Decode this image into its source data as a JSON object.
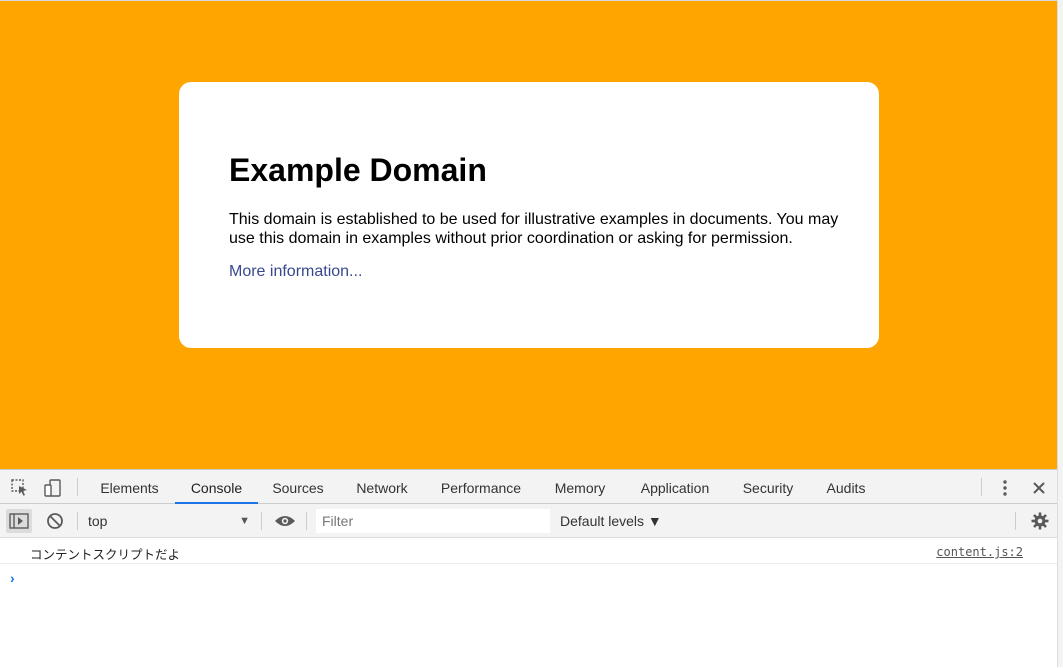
{
  "page": {
    "heading": "Example Domain",
    "body": "This domain is established to be used for illustrative examples in documents. You may use this domain in examples without prior coordination or asking for permission.",
    "link": "More information...",
    "background_color": "#ffa500"
  },
  "devtools": {
    "tabs": [
      "Elements",
      "Console",
      "Sources",
      "Network",
      "Performance",
      "Memory",
      "Application",
      "Security",
      "Audits"
    ],
    "active_tab": "Console",
    "context": "top",
    "filter_placeholder": "Filter",
    "levels": "Default levels ▼",
    "log": {
      "message": "コンテントスクリプトだよ",
      "source": "content.js:2"
    },
    "prompt": "›",
    "icons": [
      "inspect-icon",
      "device-toolbar-icon",
      "more-icon",
      "close-icon",
      "sidebar-toggle-icon",
      "clear-console-icon",
      "eye-icon",
      "settings-icon"
    ]
  }
}
